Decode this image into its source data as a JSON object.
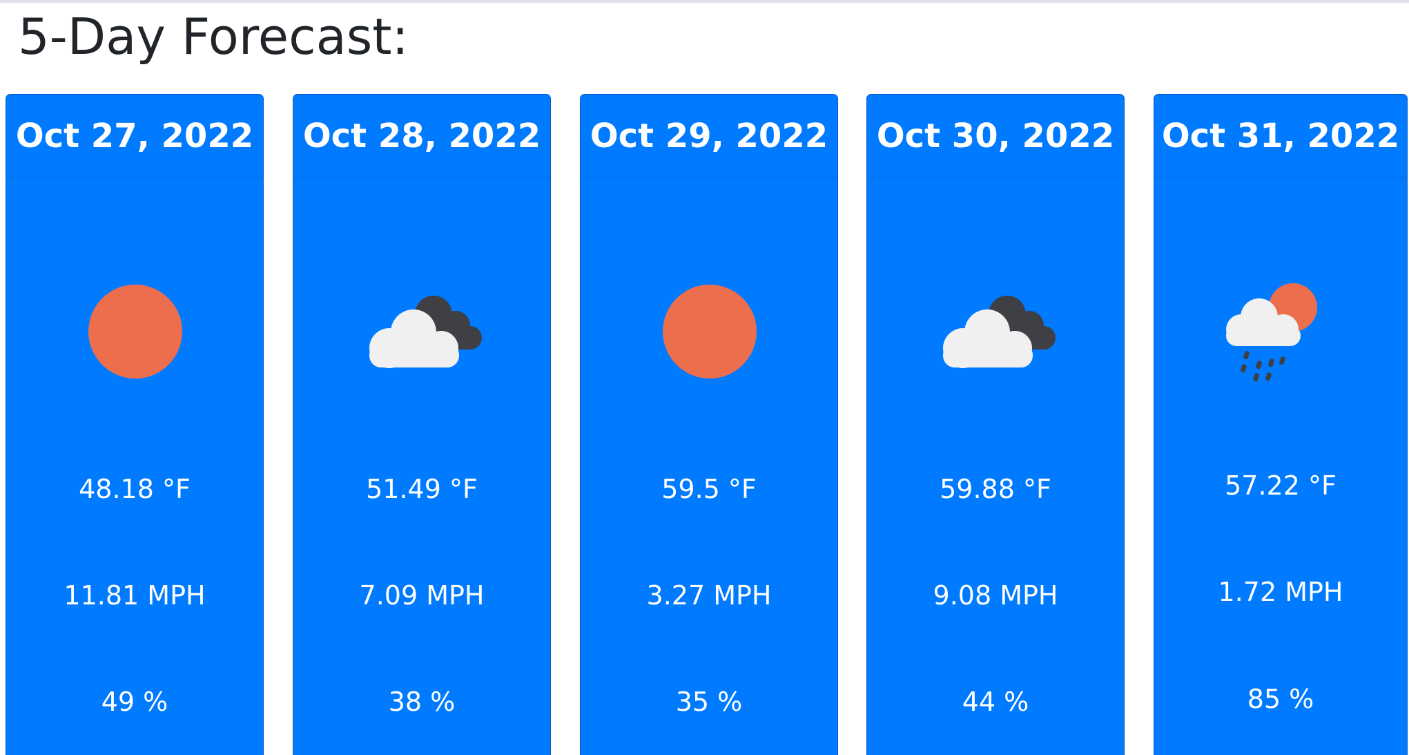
{
  "heading": "5-Day Forecast:",
  "colors": {
    "card_background": "#007bff",
    "sun": "#ec6e4c",
    "cloud": "#f0f0f0",
    "dark_cloud": "#3f3f46"
  },
  "forecast": [
    {
      "date": "Oct 27, 2022",
      "icon": "sun-icon",
      "temp": "48.18 °F",
      "wind": "11.81 MPH",
      "humidity": "49 %"
    },
    {
      "date": "Oct 28, 2022",
      "icon": "cloudy-icon",
      "temp": "51.49 °F",
      "wind": "7.09 MPH",
      "humidity": "38 %"
    },
    {
      "date": "Oct 29, 2022",
      "icon": "sun-icon",
      "temp": "59.5 °F",
      "wind": "3.27 MPH",
      "humidity": "35 %"
    },
    {
      "date": "Oct 30, 2022",
      "icon": "cloudy-icon",
      "temp": "59.88 °F",
      "wind": "9.08 MPH",
      "humidity": "44 %"
    },
    {
      "date": "Oct 31, 2022",
      "icon": "sun-rain-icon",
      "temp": "57.22 °F",
      "wind": "1.72 MPH",
      "humidity": "85 %"
    }
  ]
}
